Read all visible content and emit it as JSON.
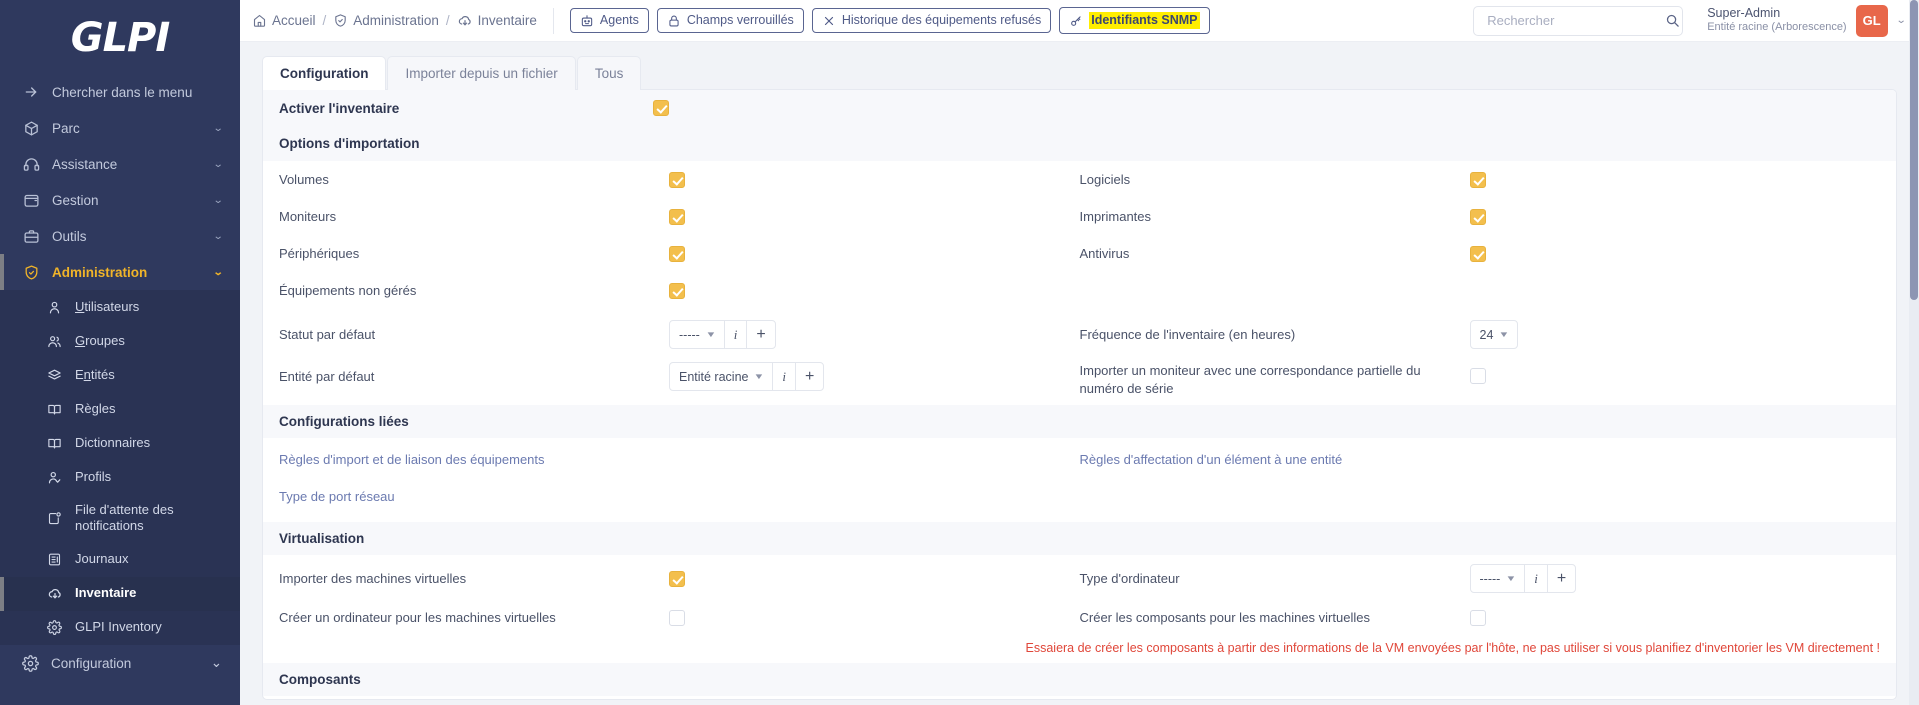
{
  "sidebar": {
    "logo": "GLPI",
    "search_menu": {
      "label": "Chercher dans le menu",
      "icon": "arrow-right-icon"
    },
    "items": [
      {
        "label": "Parc",
        "icon": "box-icon",
        "expandable": true
      },
      {
        "label": "Assistance",
        "icon": "headset-icon",
        "expandable": true
      },
      {
        "label": "Gestion",
        "icon": "wallet-icon",
        "expandable": true
      },
      {
        "label": "Outils",
        "icon": "briefcase-icon",
        "expandable": true
      },
      {
        "label": "Administration",
        "icon": "shield-icon",
        "expandable": true,
        "active": true
      }
    ],
    "subitems": [
      {
        "label": "Utilisateurs",
        "accel": "U",
        "icon": "user-icon"
      },
      {
        "label": "Groupes",
        "accel": "G",
        "icon": "users-icon"
      },
      {
        "label": "Entités",
        "accel": "n",
        "icon": "layers-icon"
      },
      {
        "label": "Règles",
        "accel": "",
        "icon": "book-icon"
      },
      {
        "label": "Dictionnaires",
        "accel": "",
        "icon": "book-icon"
      },
      {
        "label": "Profils",
        "accel": "",
        "icon": "user-check-icon"
      },
      {
        "label": "File d'attente des notifications",
        "accel": "",
        "icon": "notification-icon"
      },
      {
        "label": "Journaux",
        "accel": "",
        "icon": "list-icon"
      },
      {
        "label": "Inventaire",
        "accel": "",
        "icon": "cloud-download-icon",
        "current": true
      },
      {
        "label": "GLPI Inventory",
        "accel": "",
        "icon": "gear-icon"
      }
    ],
    "config": {
      "label": "Configuration",
      "icon": "gear-icon"
    }
  },
  "topbar": {
    "breadcrumb": [
      {
        "label": "Accueil",
        "icon": "home-icon"
      },
      {
        "label": "Administration",
        "icon": "shield-icon"
      },
      {
        "label": "Inventaire",
        "icon": "cloud-download-icon"
      }
    ],
    "separator": "/",
    "pills": [
      {
        "label": "Agents",
        "icon": "robot-icon",
        "highlight": false
      },
      {
        "label": "Champs verrouillés",
        "icon": "lock-icon",
        "highlight": false
      },
      {
        "label": "Historique des équipements refusés",
        "icon": "close-icon",
        "highlight": false
      },
      {
        "label": "Identifiants SNMP",
        "icon": "key-icon",
        "highlight": true
      }
    ],
    "search": {
      "placeholder": "Rechercher",
      "value": "",
      "icon": "search-icon"
    },
    "user": {
      "name": "Super-Admin",
      "entity": "Entité racine (Arborescence)",
      "initials": "GL",
      "avatar_color": "#e8674a"
    }
  },
  "tabs": [
    {
      "label": "Configuration",
      "active": true
    },
    {
      "label": "Importer depuis un fichier",
      "active": false
    },
    {
      "label": "Tous",
      "active": false
    }
  ],
  "form": {
    "enable_section": {
      "title": "Activer l'inventaire",
      "checked": true
    },
    "import_section_title": "Options d'importation",
    "import_left": [
      {
        "label": "Volumes",
        "type": "checkbox",
        "checked": true
      },
      {
        "label": "Moniteurs",
        "type": "checkbox",
        "checked": true
      },
      {
        "label": "Périphériques",
        "type": "checkbox",
        "checked": true
      },
      {
        "label": "Équipements non gérés",
        "type": "checkbox",
        "checked": true
      }
    ],
    "import_right": [
      {
        "label": "Logiciels",
        "type": "checkbox",
        "checked": true
      },
      {
        "label": "Imprimantes",
        "type": "checkbox",
        "checked": true
      },
      {
        "label": "Antivirus",
        "type": "checkbox",
        "checked": true
      }
    ],
    "default_status": {
      "label": "Statut par défaut",
      "value": "-----",
      "info_btn": "i",
      "add_btn": "+"
    },
    "default_entity": {
      "label": "Entité par défaut",
      "value": "Entité racine",
      "info_btn": "i",
      "add_btn": "+"
    },
    "inventory_frequency": {
      "label": "Fréquence de l'inventaire (en heures)",
      "value": "24"
    },
    "partial_serial": {
      "label": "Importer un moniteur avec une correspondance partielle du numéro de série",
      "checked": false
    },
    "linked_config_title": "Configurations liées",
    "linked_links_left": [
      {
        "label": "Règles d'import et de liaison des équipements"
      },
      {
        "label": "Type de port réseau"
      }
    ],
    "linked_links_right": [
      {
        "label": "Règles d'affectation d'un élément à une entité"
      }
    ],
    "virtualisation_title": "Virtualisation",
    "vm_import": {
      "label": "Importer des machines virtuelles",
      "checked": true
    },
    "vm_computer_type": {
      "label": "Type d'ordinateur",
      "value": "-----",
      "info_btn": "i",
      "add_btn": "+"
    },
    "vm_create_computer": {
      "label": "Créer un ordinateur pour les machines virtuelles",
      "checked": false
    },
    "vm_create_components": {
      "label": "Créer les composants pour les machines virtuelles",
      "checked": false
    },
    "vm_warning": "Essaiera de créer les composants à partir des informations de la VM envoyées par l'hôte, ne pas utiliser si vous planifiez d'inventorier les VM directement !",
    "components_title": "Composants"
  },
  "colors": {
    "sidebar_bg": "#2f395e",
    "accent_yellow": "#f0b429",
    "checkbox_on": "#f3bf4d",
    "warning_red": "#e0473a",
    "avatar": "#e8674a",
    "highlight_yellow": "#ffee00"
  }
}
